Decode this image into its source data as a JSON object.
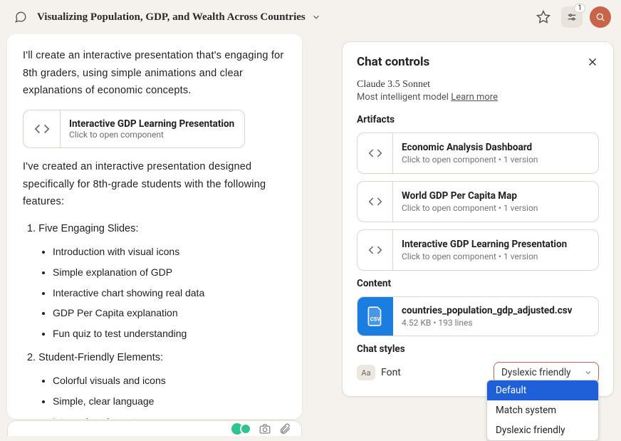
{
  "header": {
    "title": "Visualizing Population, GDP, and Wealth Across Countries",
    "settings_badge": "1"
  },
  "chat": {
    "intro": "I'll create an interactive presentation that's engaging for 8th graders, using simple animations and clear explanations of economic concepts.",
    "artifact_chip": {
      "title": "Interactive GDP Learning Presentation",
      "sub": "Click to open component"
    },
    "followup": "I've created an interactive presentation designed specifically for 8th-grade students with the following features:",
    "ol": [
      {
        "label": "Five Engaging Slides:",
        "items": [
          "Introduction with visual icons",
          "Simple explanation of GDP",
          "Interactive chart showing real data",
          "GDP Per Capita explanation",
          "Fun quiz to test understanding"
        ]
      },
      {
        "label": "Student-Friendly Elements:",
        "items": [
          "Colorful visuals and icons",
          "Simple, clear language",
          "Interactive elements"
        ]
      }
    ]
  },
  "controls": {
    "title": "Chat controls",
    "model_name": "Claude 3.5 Sonnet",
    "model_tagline": "Most intelligent model ",
    "learn_more": "Learn more",
    "artifacts_label": "Artifacts",
    "artifacts": [
      {
        "title": "Economic Analysis Dashboard",
        "sub": "Click to open component • 1 version"
      },
      {
        "title": "World GDP Per Capita Map",
        "sub": "Click to open component • 1 version"
      },
      {
        "title": "Interactive GDP Learning Presentation",
        "sub": "Click to open component • 1 version"
      }
    ],
    "content_label": "Content",
    "file": {
      "name": "countries_population_gdp_adjusted.csv",
      "meta": "4.52 KB  • 193 lines"
    },
    "styles_label": "Chat styles",
    "font_label": "Font",
    "font_selected": "Dyslexic friendly",
    "font_options": [
      "Default",
      "Match system",
      "Dyslexic friendly"
    ]
  }
}
